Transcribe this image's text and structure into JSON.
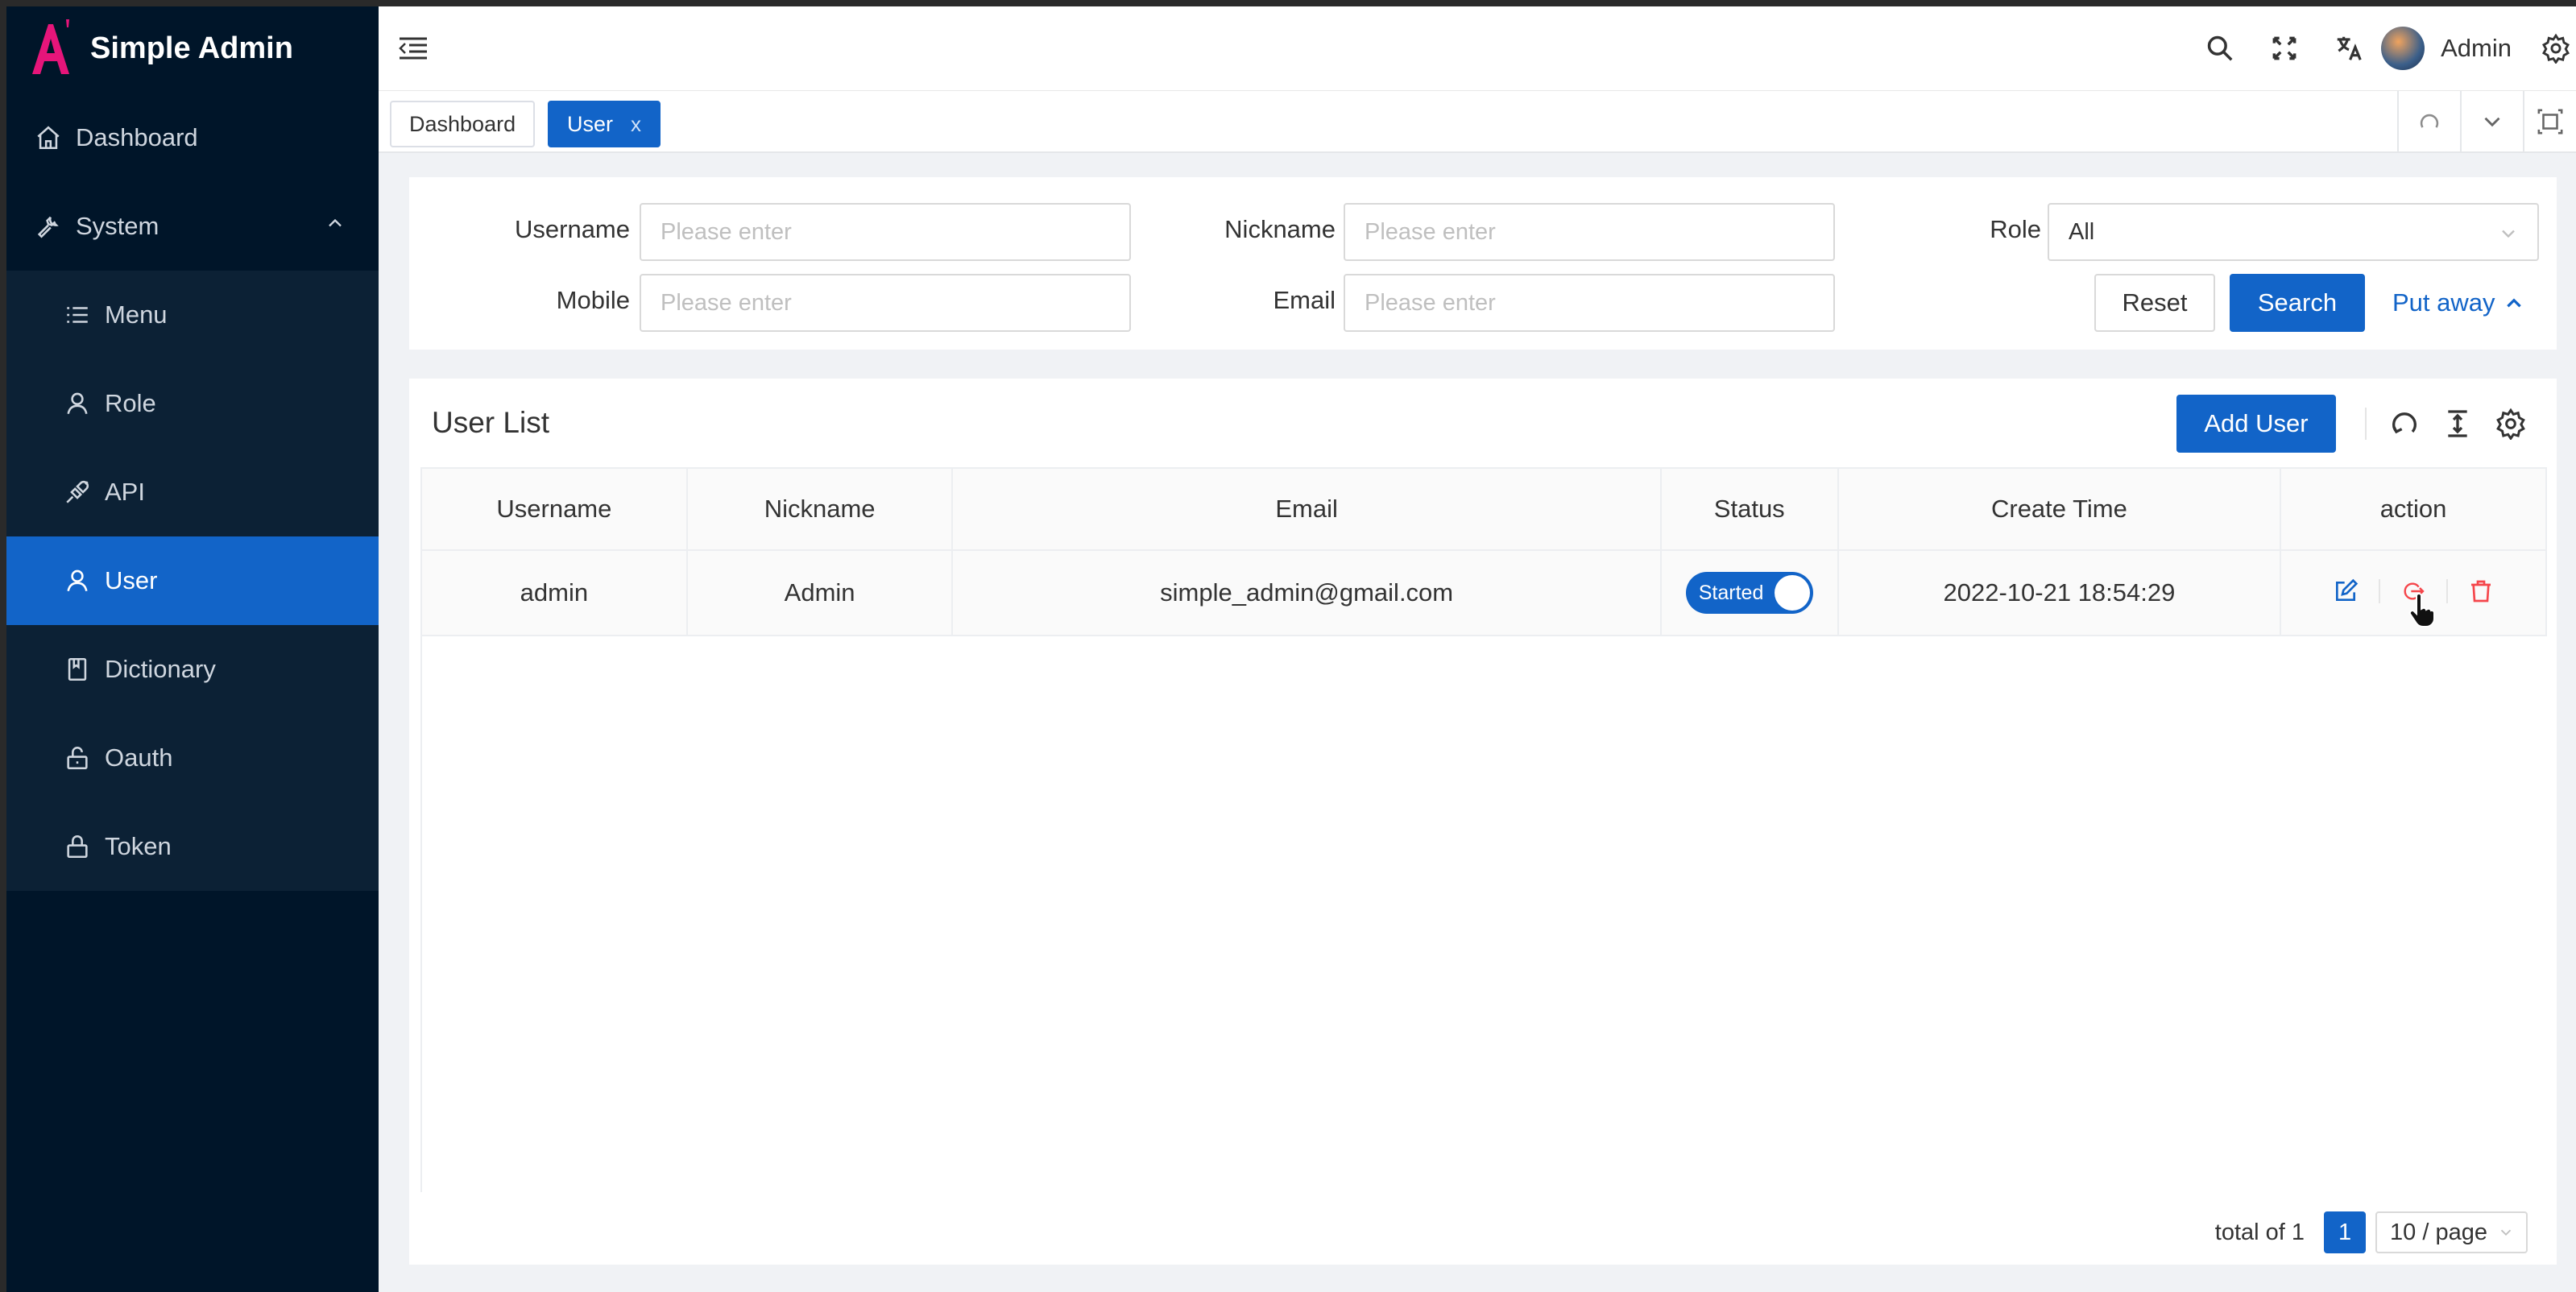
{
  "app": {
    "title": "Simple Admin"
  },
  "colors": {
    "primary": "#1264c8",
    "sidebar": "#001529",
    "danger": "#f5464b"
  },
  "sidebar": {
    "items": [
      {
        "label": "Dashboard",
        "icon": "home-icon"
      },
      {
        "label": "System",
        "icon": "wrench-icon",
        "expanded": true
      },
      {
        "label": "Menu",
        "icon": "list-icon"
      },
      {
        "label": "Role",
        "icon": "user-icon"
      },
      {
        "label": "API",
        "icon": "plug-icon"
      },
      {
        "label": "User",
        "icon": "user-icon",
        "active": true
      },
      {
        "label": "Dictionary",
        "icon": "book-icon"
      },
      {
        "label": "Oauth",
        "icon": "unlock-icon"
      },
      {
        "label": "Token",
        "icon": "lock-icon"
      }
    ]
  },
  "header": {
    "user_name": "Admin"
  },
  "tabs": [
    {
      "label": "Dashboard"
    },
    {
      "label": "User",
      "close": "x",
      "active": true
    }
  ],
  "filter": {
    "username_label": "Username",
    "nickname_label": "Nickname",
    "role_label": "Role",
    "mobile_label": "Mobile",
    "email_label": "Email",
    "placeholder": "Please enter",
    "role_value": "All",
    "reset_label": "Reset",
    "search_label": "Search",
    "collapse_label": "Put away"
  },
  "list": {
    "title": "User List",
    "add_label": "Add User",
    "columns": [
      "Username",
      "Nickname",
      "Email",
      "Status",
      "Create Time",
      "action"
    ],
    "rows": [
      {
        "username": "admin",
        "nickname": "Admin",
        "email": "simple_admin@gmail.com",
        "status": "Started",
        "status_on": true,
        "create_time": "2022-10-21 18:54:29"
      }
    ]
  },
  "pagination": {
    "total_text": "total of 1",
    "current_page": "1",
    "page_size": "10 / page"
  }
}
